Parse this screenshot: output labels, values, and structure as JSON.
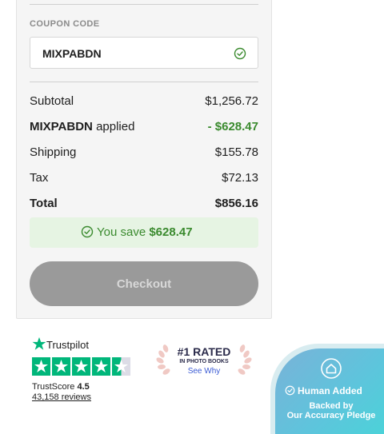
{
  "coupon": {
    "label": "COUPON CODE",
    "value": "MIXPABDN"
  },
  "summary": {
    "subtotal_label": "Subtotal",
    "subtotal_value": "$1,256.72",
    "discount_code": "MIXPABDN",
    "discount_suffix": "applied",
    "discount_value": "- $628.47",
    "shipping_label": "Shipping",
    "shipping_value": "$155.78",
    "tax_label": "Tax",
    "tax_value": "$72.13",
    "total_label": "Total",
    "total_value": "$856.16"
  },
  "savings": {
    "prefix": "You save",
    "amount": "$628.47"
  },
  "checkout": {
    "label": "Checkout"
  },
  "trustpilot": {
    "brand": "Trustpilot",
    "score_label": "TrustScore",
    "score_value": "4.5",
    "reviews": "43,158 reviews",
    "rating": 4.5
  },
  "rated_badge": {
    "title": "#1 RATED",
    "subtitle": "IN PHOTO BOOKS",
    "link": "See Why"
  },
  "accuracy_badge": {
    "title": "Human Added",
    "line1": "Backed by",
    "line2": "Our Accuracy Pledge"
  },
  "colors": {
    "green": "#3a8a2e",
    "trustpilot_green": "#00b67a",
    "checkout_disabled": "#9a9a9a",
    "badge_teal": "#49d4d8"
  },
  "icons": [
    "check-circle-icon",
    "trustpilot-star-icon",
    "laurel-icon",
    "home-icon"
  ]
}
